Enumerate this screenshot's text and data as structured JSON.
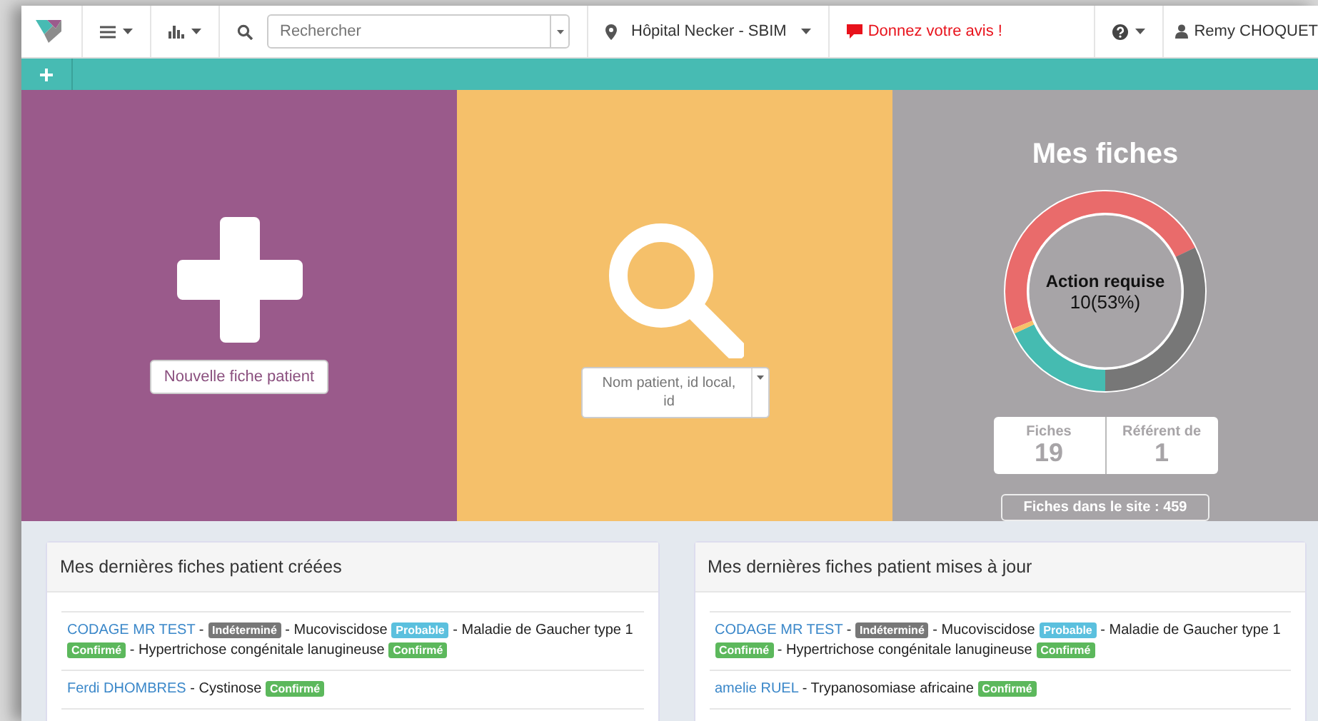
{
  "navbar": {
    "search": {
      "placeholder": "Rechercher"
    },
    "site": "Hôpital Necker - SBIM",
    "feedback": "Donnez votre avis !",
    "user": "Remy CHOQUET"
  },
  "tiles": {
    "new_patient": {
      "button": "Nouvelle fiche patient"
    },
    "patient_search": {
      "placeholder": "Nom patient, id local, id"
    },
    "my_records": {
      "title": "Mes fiches",
      "donut_label": "Action requise",
      "donut_value": "10(53%)",
      "stats": [
        {
          "label": "Fiches",
          "value": "19"
        },
        {
          "label": "Référent de",
          "value": "1"
        }
      ],
      "site_button": "Fiches dans le site : 459"
    }
  },
  "separator": "-",
  "panels": [
    {
      "title": "Mes dernières fiches patient créées",
      "items": [
        {
          "patient": "CODAGE MR TEST",
          "diagnoses": [
            {
              "status": "Indéterminé",
              "kind": "undetermined"
            },
            {
              "name": "Mucoviscidose",
              "status": "Probable",
              "kind": "probable"
            },
            {
              "name": "Maladie de Gaucher type 1",
              "status": "Confirmé",
              "kind": "confirmed"
            },
            {
              "name": "Hypertrichose congénitale lanugineuse",
              "status": "Confirmé",
              "kind": "confirmed"
            }
          ]
        },
        {
          "patient": "Ferdi DHOMBRES",
          "diagnoses": [
            {
              "name": "Cystinose",
              "status": "Confirmé",
              "kind": "confirmed"
            }
          ]
        }
      ]
    },
    {
      "title": "Mes dernières fiches patient mises à jour",
      "items": [
        {
          "patient": "CODAGE MR TEST",
          "diagnoses": [
            {
              "status": "Indéterminé",
              "kind": "undetermined"
            },
            {
              "name": "Mucoviscidose",
              "status": "Probable",
              "kind": "probable"
            },
            {
              "name": "Maladie de Gaucher type 1",
              "status": "Confirmé",
              "kind": "confirmed"
            },
            {
              "name": "Hypertrichose congénitale lanugineuse",
              "status": "Confirmé",
              "kind": "confirmed"
            }
          ]
        },
        {
          "patient": "amelie RUEL",
          "diagnoses": [
            {
              "name": "Trypanosomiase africaine",
              "status": "Confirmé",
              "kind": "confirmed"
            }
          ]
        }
      ]
    }
  ]
}
